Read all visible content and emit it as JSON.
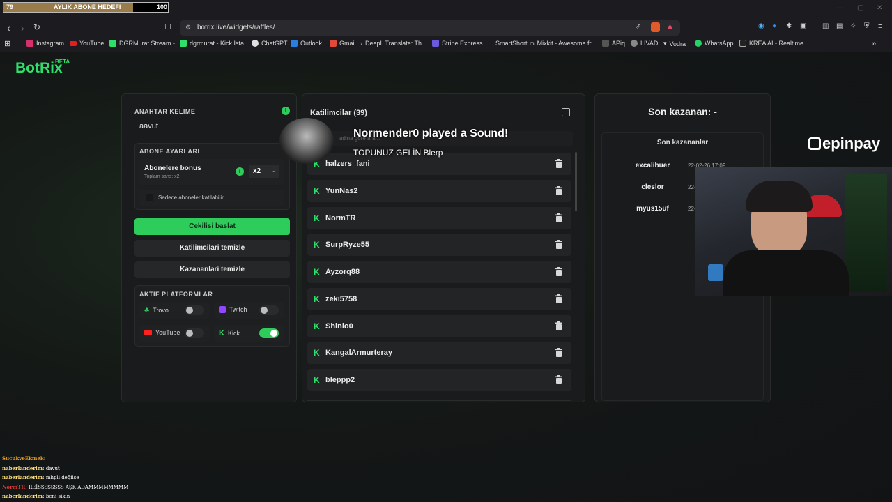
{
  "goal": {
    "current": "79",
    "label": "AYLIK ABONE HEDEFI",
    "target": "100",
    "progress_fraction": 0.79
  },
  "browser": {
    "url": "botrix.live/widgets/raffles/"
  },
  "bookmarks": [
    "Instagram",
    "YouTube",
    "DGRMurat Stream -...",
    "dgrmurat - Kick İsta...",
    "ChatGPT",
    "Outlook",
    "Gmail",
    "DeepL Translate: Th...",
    "Stripe Express",
    "SmartShort",
    "Mixkit - Awesome fr...",
    "APiq",
    "LIVAD",
    "Vodra",
    "WhatsApp",
    "KREA AI - Realtime..."
  ],
  "app": {
    "logo": "BotRix",
    "beta": "BETA"
  },
  "settings": {
    "keyword_label": "ANAHTAR KELIME",
    "keyword_value": "aavut",
    "sub_settings_label": "ABONE AYARLARI",
    "sub_bonus_title": "Abonelere bonus",
    "sub_bonus_sub": "Toplam sans: x2",
    "multiplier": "x2",
    "subs_only": "Sadece aboneler katilabilir",
    "start_button": "Cekilisi baslat",
    "clear_participants": "Katilimcilari temizle",
    "clear_winners": "Kazananlari temizle",
    "platforms_label": "AKTIF PLATFORMLAR",
    "platforms": [
      {
        "name": "Trovo",
        "on": false
      },
      {
        "name": "Twitch",
        "on": false
      },
      {
        "name": "YouTube",
        "on": false
      },
      {
        "name": "Kick",
        "on": true
      }
    ]
  },
  "participants": {
    "title": "Katilimcilar (39)",
    "search_placeholder": "adina göre ara...",
    "list": [
      "halzers_fani",
      "YunNas2",
      "NormTR",
      "SurpRyze55",
      "Ayzorq88",
      "zeki5758",
      "Shinio0",
      "KangalArmurteray",
      "bleppp2"
    ]
  },
  "overlay": {
    "title": "Normender0 played a Sound!",
    "subtitle": "TOPUNUZ GELİN Blerp"
  },
  "winners": {
    "last_winner": "Son kazanan: -",
    "recent_label": "Son kazananlar",
    "list": [
      {
        "name": "excalibuer",
        "time": "22-02-26 17:09"
      },
      {
        "name": "cleslor",
        "time": "22-02"
      },
      {
        "name": "myus15uf",
        "time": "22-"
      }
    ]
  },
  "sponsor": "epinpay",
  "chat": [
    {
      "user": "SucukveEkmek:",
      "msg": ""
    },
    {
      "user": "naberlanderim:",
      "msg": "davut"
    },
    {
      "user": "naberlanderim:",
      "msg": "mhpli değilse"
    },
    {
      "user": "NormTR:",
      "msg": "REİSSSSSSSS AŞK ADAMMMMMMMM"
    },
    {
      "user": "naberlanderim:",
      "msg": "beni sikin"
    }
  ],
  "colors": {
    "accent": "#2ecc5a",
    "background": "#121315",
    "panel": "#1a1b1c"
  }
}
